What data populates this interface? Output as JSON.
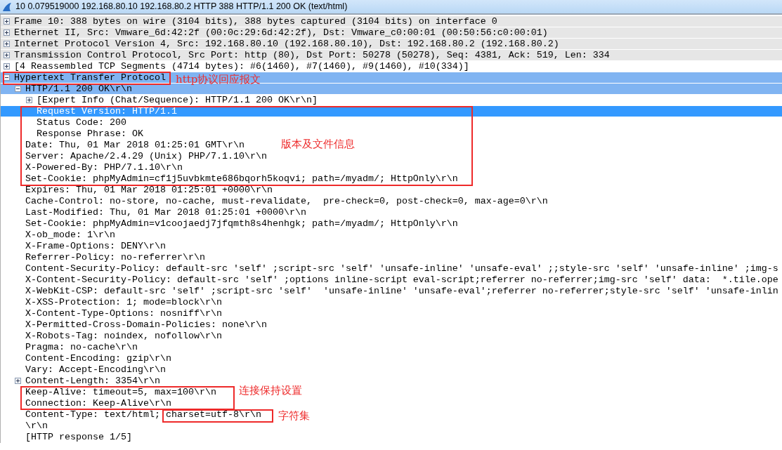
{
  "window": {
    "title": "10 0.079519000 192.168.80.10 192.168.80.2 HTTP 388 HTTP/1.1 200 OK  (text/html)"
  },
  "tree": [
    {
      "text": "Frame 10: 388 bytes on wire (3104 bits), 388 bytes captured (3104 bits) on interface 0",
      "expanded": false,
      "color": "#e6e6e6",
      "selected": false
    },
    {
      "text": "Ethernet II, Src: Vmware_6d:42:2f (00:0c:29:6d:42:2f), Dst: Vmware_c0:00:01 (00:50:56:c0:00:01)",
      "expanded": false,
      "color": "#e6e6e6",
      "selected": false
    },
    {
      "text": "Internet Protocol Version 4, Src: 192.168.80.10 (192.168.80.10), Dst: 192.168.80.2 (192.168.80.2)",
      "expanded": false,
      "color": "#e6e6e6",
      "selected": false
    },
    {
      "text": "Transmission Control Protocol, Src Port: http (80), Dst Port: 50278 (50278), Seq: 4381, Ack: 519, Len: 334",
      "expanded": false,
      "color": "#e6e6e6",
      "selected": false
    },
    {
      "text": "[4 Reassembled TCP Segments (4714 bytes): #6(1460), #7(1460), #9(1460), #10(334)]",
      "expanded": false,
      "selected": false
    },
    {
      "text": "Hypertext Transfer Protocol",
      "expanded": true,
      "color": "#80b4f2",
      "selected": false,
      "children": [
        {
          "text": "HTTP/1.1 200 OK\\r\\n",
          "expanded": true,
          "color": "#80b4f2",
          "selected": false,
          "children": [
            {
              "text": "[Expert Info (Chat/Sequence): HTTP/1.1 200 OK\\r\\n]",
              "expanded": false,
              "selected": false
            },
            {
              "text": "Request Version: HTTP/1.1",
              "selected": true
            },
            {
              "text": "Status Code: 200",
              "selected": false
            },
            {
              "text": "Response Phrase: OK",
              "selected": false
            }
          ]
        },
        {
          "text": "Date: Thu, 01 Mar 2018 01:25:01 GMT\\r\\n",
          "selected": false
        },
        {
          "text": "Server: Apache/2.4.29 (Unix) PHP/7.1.10\\r\\n",
          "selected": false
        },
        {
          "text": "X-Powered-By: PHP/7.1.10\\r\\n",
          "selected": false
        },
        {
          "text": "Set-Cookie: phpMyAdmin=cf1j5uvbkmte686bqorh5koqvi; path=/myadm/; HttpOnly\\r\\n",
          "selected": false
        },
        {
          "text": "Expires: Thu, 01 Mar 2018 01:25:01 +0000\\r\\n",
          "selected": false
        },
        {
          "text": "Cache-Control: no-store, no-cache, must-revalidate,  pre-check=0, post-check=0, max-age=0\\r\\n",
          "selected": false
        },
        {
          "text": "Last-Modified: Thu, 01 Mar 2018 01:25:01 +0000\\r\\n",
          "selected": false
        },
        {
          "text": "Set-Cookie: phpMyAdmin=v1coojaedj7jfqmth8s4henhgk; path=/myadm/; HttpOnly\\r\\n",
          "selected": false
        },
        {
          "text": "X-ob_mode: 1\\r\\n",
          "selected": false
        },
        {
          "text": "X-Frame-Options: DENY\\r\\n",
          "selected": false
        },
        {
          "text": "Referrer-Policy: no-referrer\\r\\n",
          "selected": false
        },
        {
          "text": "Content-Security-Policy: default-src 'self' ;script-src 'self' 'unsafe-inline' 'unsafe-eval' ;;style-src 'self' 'unsafe-inline' ;img-s",
          "selected": false
        },
        {
          "text": "X-Content-Security-Policy: default-src 'self' ;options inline-script eval-script;referrer no-referrer;img-src 'self' data:  *.tile.ope",
          "selected": false
        },
        {
          "text": "X-WebKit-CSP: default-src 'self' ;script-src 'self'  'unsafe-inline' 'unsafe-eval';referrer no-referrer;style-src 'self' 'unsafe-inlin",
          "selected": false
        },
        {
          "text": "X-XSS-Protection: 1; mode=block\\r\\n",
          "selected": false
        },
        {
          "text": "X-Content-Type-Options: nosniff\\r\\n",
          "selected": false
        },
        {
          "text": "X-Permitted-Cross-Domain-Policies: none\\r\\n",
          "selected": false
        },
        {
          "text": "X-Robots-Tag: noindex, nofollow\\r\\n",
          "selected": false
        },
        {
          "text": "Pragma: no-cache\\r\\n",
          "selected": false
        },
        {
          "text": "Content-Encoding: gzip\\r\\n",
          "selected": false
        },
        {
          "text": "Vary: Accept-Encoding\\r\\n",
          "selected": false
        },
        {
          "text": "Content-Length: 3354\\r\\n",
          "expanded": false,
          "selected": false
        },
        {
          "text": "Keep-Alive: timeout=5, max=100\\r\\n",
          "selected": false
        },
        {
          "text": "Connection: Keep-Alive\\r\\n",
          "selected": false
        },
        {
          "text": "Content-Type: text/html; charset=utf-8\\r\\n",
          "selected": false
        },
        {
          "text": "\\r\\n",
          "selected": false
        },
        {
          "text": "[HTTP response 1/5]",
          "selected": false
        }
      ]
    }
  ],
  "annotations": [
    {
      "text": "http协议回应报文"
    },
    {
      "text": "版本及文件信息"
    },
    {
      "text": "连接保持设置"
    },
    {
      "text": "字符集"
    }
  ]
}
